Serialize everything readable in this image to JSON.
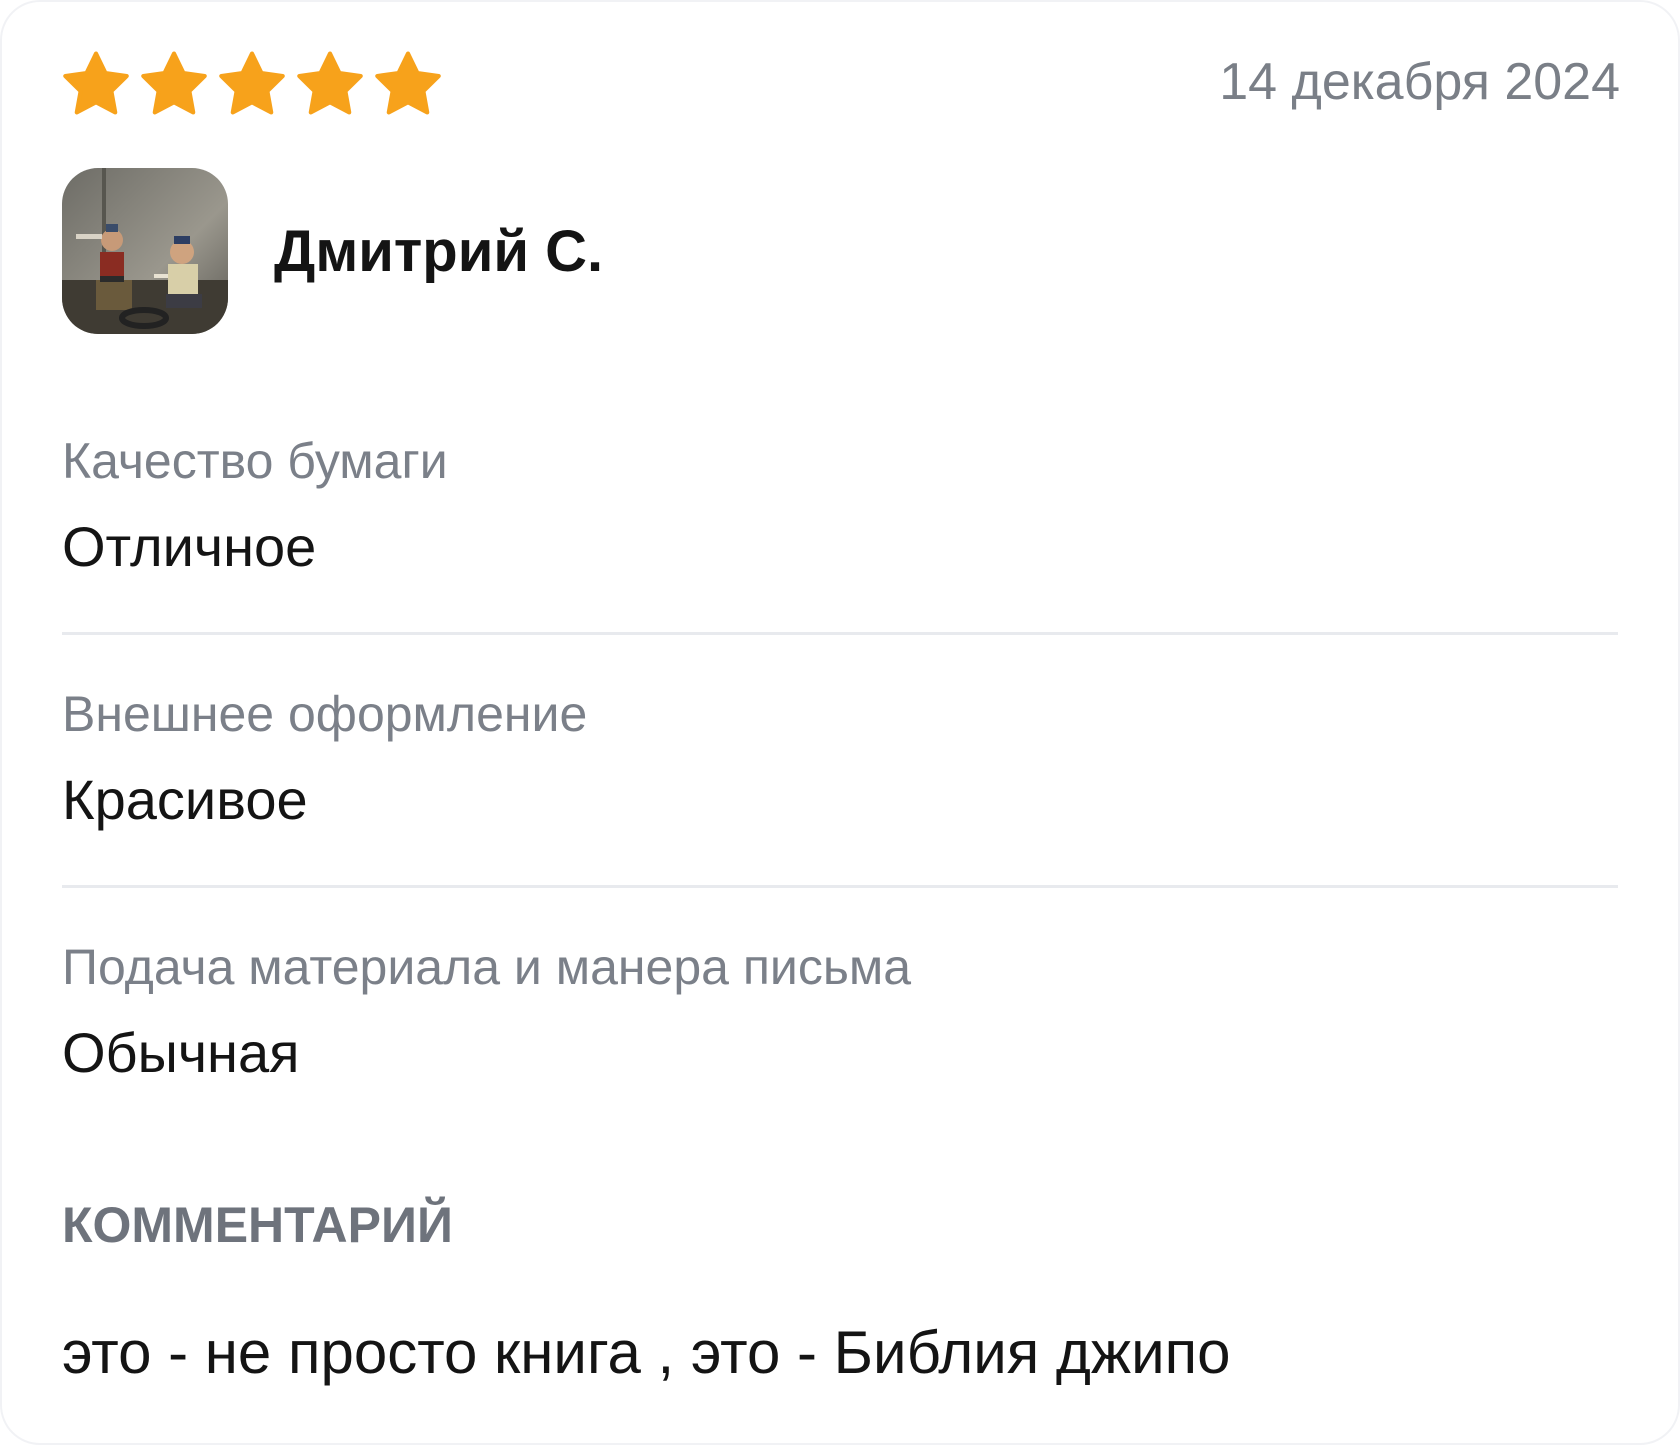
{
  "review": {
    "rating": 5,
    "rating_max": 5,
    "star_color": "#f7a21b",
    "date": "14 декабря 2024",
    "author": "Дмитрий С.",
    "criteria": [
      {
        "label": "Качество бумаги",
        "value": "Отличное"
      },
      {
        "label": "Внешнее оформление",
        "value": "Красивое"
      },
      {
        "label": "Подача материала и манера письма",
        "value": "Обычная"
      }
    ],
    "comment_title": "КОММЕНТАРИЙ",
    "comment": "это - не просто книга , это - Библия джипо"
  }
}
